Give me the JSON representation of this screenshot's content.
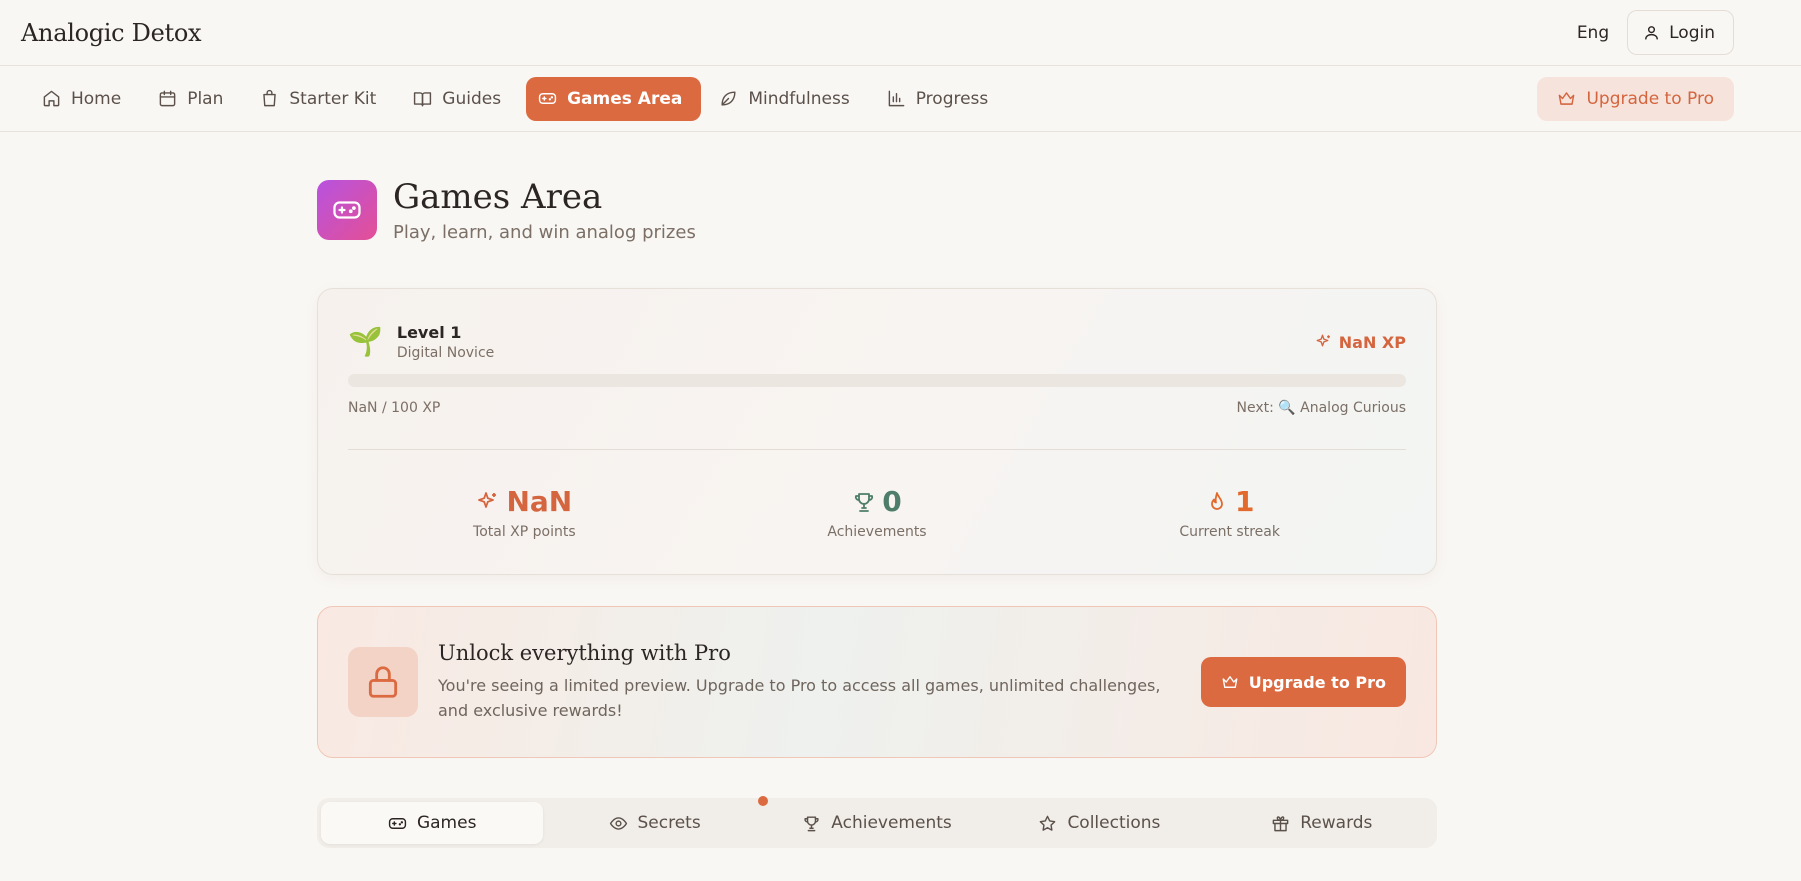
{
  "topbar": {
    "brand": "Analogic Detox",
    "lang": "Eng",
    "login_label": "Login"
  },
  "nav": {
    "items": [
      {
        "label": "Home",
        "icon": "home-icon"
      },
      {
        "label": "Plan",
        "icon": "calendar-icon"
      },
      {
        "label": "Starter Kit",
        "icon": "bag-icon"
      },
      {
        "label": "Guides",
        "icon": "book-icon"
      },
      {
        "label": "Games Area",
        "icon": "gamepad-icon",
        "active": true
      },
      {
        "label": "Mindfulness",
        "icon": "leaf-icon"
      },
      {
        "label": "Progress",
        "icon": "chart-icon"
      }
    ],
    "upgrade_label": "Upgrade to Pro"
  },
  "page": {
    "title": "Games Area",
    "subtitle": "Play, learn, and win analog prizes"
  },
  "level": {
    "emoji": "🌱",
    "title": "Level 1",
    "subtitle": "Digital Novice",
    "xp_badge": "NaN XP",
    "progress_text": "NaN / 100 XP",
    "progress_fraction": 0,
    "next_label": "Next: 🔍 Analog Curious"
  },
  "stats": [
    {
      "value": "NaN",
      "label": "Total XP points",
      "icon": "sparkle-icon",
      "color": "#d4653f"
    },
    {
      "value": "0",
      "label": "Achievements",
      "icon": "trophy-icon",
      "color": "#4f7d6b"
    },
    {
      "value": "1",
      "label": "Current streak",
      "icon": "flame-icon",
      "color": "#e26a2c"
    }
  ],
  "pro": {
    "title": "Unlock everything with Pro",
    "description": "You're seeing a limited preview. Upgrade to Pro to access all games, unlimited challenges, and exclusive rewards!",
    "button_label": "Upgrade to Pro"
  },
  "tabs": [
    {
      "label": "Games",
      "icon": "gamepad-icon",
      "active": true
    },
    {
      "label": "Secrets",
      "icon": "eye-icon"
    },
    {
      "label": "Achievements",
      "icon": "trophy-icon"
    },
    {
      "label": "Collections",
      "icon": "star-icon"
    },
    {
      "label": "Rewards",
      "icon": "gift-icon"
    }
  ],
  "colors": {
    "accent": "#dc6a40",
    "background": "#f9f7f4"
  }
}
